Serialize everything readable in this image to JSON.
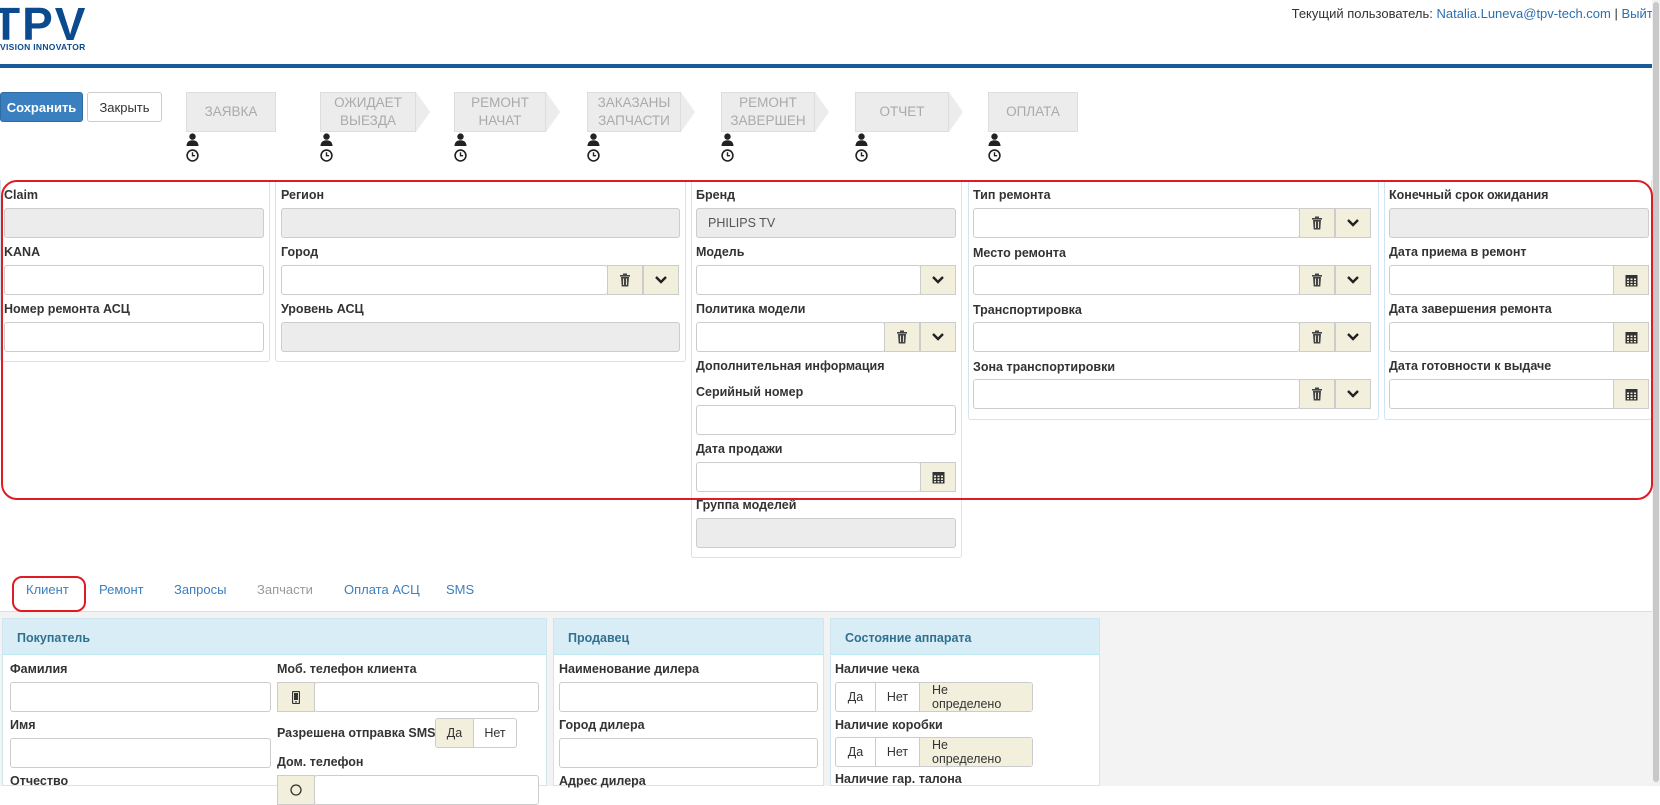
{
  "header": {
    "logo_text": "TPV",
    "logo_tagline": "VISION INNOVATOR",
    "user_prefix": "Текущий пользователь:",
    "user_email": "Natalia.Luneva@tpv-tech.com",
    "separator": "|",
    "logout": "Выйти"
  },
  "toolbar": {
    "save_label": "Сохранить",
    "close_label": "Закрыть"
  },
  "steps": [
    {
      "label": "Заявка",
      "icon_user": "user-icon",
      "icon_clock": "clock-icon"
    },
    {
      "label": "Ожидает выезда",
      "icon_user": "user-icon",
      "icon_clock": "clock-icon"
    },
    {
      "label": "Ремонт начат",
      "icon_user": "user-icon",
      "icon_clock": "clock-icon"
    },
    {
      "label": "Заказаны запчасти",
      "icon_user": "user-icon",
      "icon_clock": "clock-icon"
    },
    {
      "label": "Ремонт завершен",
      "icon_user": "user-icon",
      "icon_clock": "clock-icon"
    },
    {
      "label": "Отчет",
      "icon_user": "user-icon",
      "icon_clock": "clock-icon"
    },
    {
      "label": "Оплата",
      "icon_user": "user-icon",
      "icon_clock": "clock-icon"
    }
  ],
  "form": {
    "col1": {
      "claim": {
        "label": "Claim",
        "value": ""
      },
      "kana": {
        "label": "KANA",
        "value": ""
      },
      "asc_repair_number": {
        "label": "Номер ремонта АСЦ",
        "value": ""
      }
    },
    "col2": {
      "region": {
        "label": "Регион",
        "value": ""
      },
      "city": {
        "label": "Город",
        "value": ""
      },
      "asc_level": {
        "label": "Уровень АСЦ",
        "value": ""
      }
    },
    "col3": {
      "brand": {
        "label": "Бренд",
        "value": "PHILIPS TV"
      },
      "model": {
        "label": "Модель",
        "value": ""
      },
      "model_policy": {
        "label": "Политика модели",
        "value": ""
      },
      "additional_info": {
        "label": "Дополнительная информация"
      },
      "serial_number": {
        "label": "Серийный номер",
        "value": ""
      },
      "sale_date": {
        "label": "Дата продажи",
        "value": ""
      },
      "model_group": {
        "label": "Группа моделей",
        "value": ""
      }
    },
    "col4": {
      "repair_type": {
        "label": "Тип ремонта",
        "value": ""
      },
      "repair_place": {
        "label": "Место ремонта",
        "value": ""
      },
      "transportation": {
        "label": "Транспортировка",
        "value": ""
      },
      "transport_zone": {
        "label": "Зона транспортировки",
        "value": ""
      }
    },
    "col5": {
      "final_deadline": {
        "label": "Конечный срок ожидания",
        "value": ""
      },
      "accept_date": {
        "label": "Дата приема в ремонт",
        "value": ""
      },
      "finish_date": {
        "label": "Дата завершения ремонта",
        "value": ""
      },
      "ready_date": {
        "label": "Дата готовности к выдаче",
        "value": ""
      }
    }
  },
  "tabs": [
    {
      "label": "Клиент",
      "state": "active"
    },
    {
      "label": "Ремонт",
      "state": "normal"
    },
    {
      "label": "Запросы",
      "state": "normal"
    },
    {
      "label": "Запчасти",
      "state": "disabled"
    },
    {
      "label": "Оплата АСЦ",
      "state": "normal"
    },
    {
      "label": "SMS",
      "state": "normal"
    }
  ],
  "buyer": {
    "title": "Покупатель",
    "surname_label": "Фамилия",
    "name_label": "Имя",
    "patronymic_label": "Отчество",
    "mobile_label": "Моб. телефон клиента",
    "sms_label": "Разрешена отправка SMS",
    "sms_yes": "Да",
    "sms_no": "Нет",
    "home_phone_label": "Дом. телефон"
  },
  "seller": {
    "title": "Продавец",
    "dealer_name_label": "Наименование дилера",
    "dealer_city_label": "Город дилера",
    "dealer_address_label": "Адрес дилера"
  },
  "device_state": {
    "title": "Состояние аппарата",
    "receipt_label": "Наличие чека",
    "box_label": "Наличие коробки",
    "warranty_label": "Наличие гар. талона",
    "opt_yes": "Да",
    "opt_no": "Нет",
    "opt_undefined": "Не определено"
  },
  "colors": {
    "brand_blue": "#0b4a8f",
    "primary": "#3a7fc0",
    "highlight_red": "#e01b24",
    "addon_bg": "#f2f0dd",
    "section_head_bg": "#d9edf7"
  }
}
